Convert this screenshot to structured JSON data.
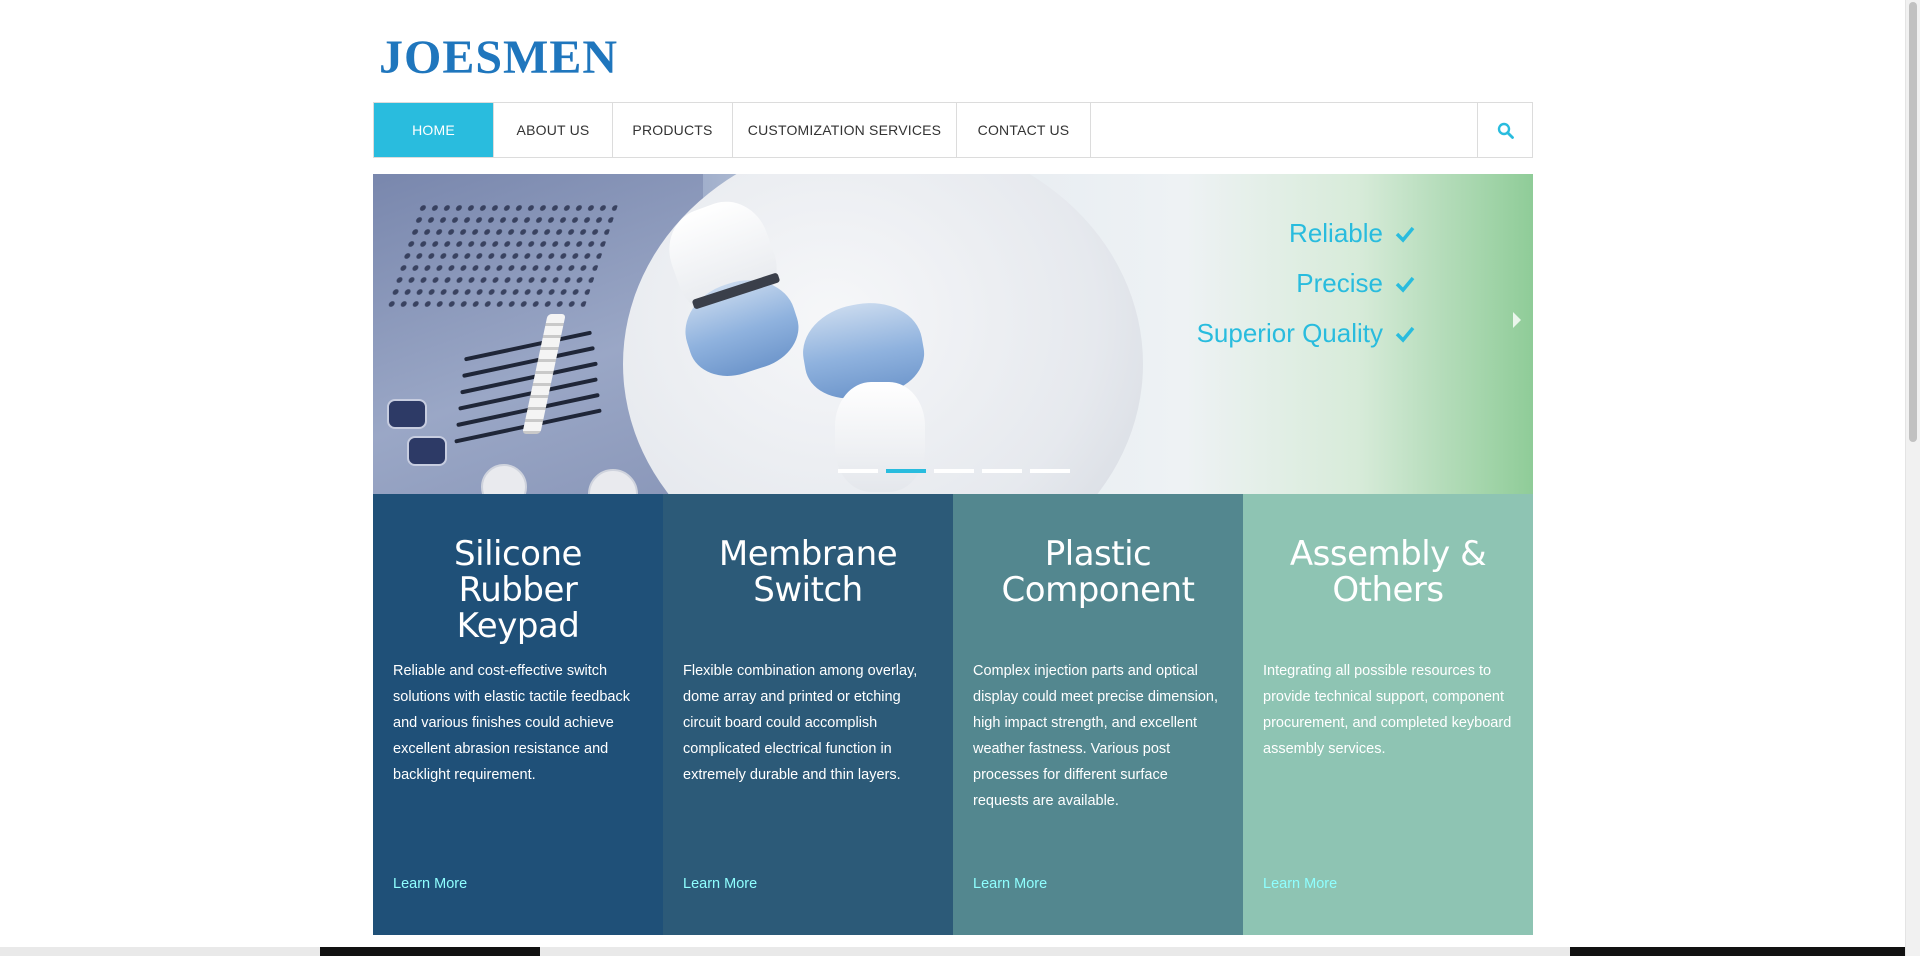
{
  "brand": {
    "logo": "JOESMEN"
  },
  "nav": {
    "items": [
      {
        "label": "HOME",
        "active": true
      },
      {
        "label": "ABOUT US",
        "active": false
      },
      {
        "label": "PRODUCTS",
        "active": false
      },
      {
        "label": "CUSTOMIZATION SERVICES",
        "active": false
      },
      {
        "label": "CONTACT US",
        "active": false
      }
    ],
    "search_icon": "search-icon"
  },
  "banner": {
    "taglines": [
      "Reliable",
      "Precise",
      "Superior Quality"
    ],
    "check_icon": "check-icon",
    "slides_total": 5,
    "active_slide": 2
  },
  "cards": [
    {
      "title": "Silicone Rubber Keypad",
      "desc": "Reliable and cost-effective switch solutions with elastic tactile feedback and various finishes could achieve excellent abrasion resistance and backlight requirement.",
      "link": "Learn More",
      "color": "#1f5078"
    },
    {
      "title": "Membrane Switch",
      "desc": "Flexible combination among overlay, dome array and printed or etching circuit board could accomplish complicated electrical function in extremely durable and thin layers.",
      "link": "Learn More",
      "color": "#2c5a78"
    },
    {
      "title": "Plastic Component",
      "desc": "Complex injection parts and optical display could meet precise dimension, high impact strength, and excellent weather fastness. Various post processes for different surface requests are available.",
      "link": "Learn More",
      "color": "#53878f"
    },
    {
      "title": "Assembly & Others",
      "desc": "Integrating all possible resources to provide technical support, component procurement, and completed keyboard assembly services.",
      "link": "Learn More",
      "color": "#8ec4b3"
    }
  ],
  "colors": {
    "accent": "#29bcde",
    "logo": "#1f76bd",
    "link": "#8fffff"
  }
}
